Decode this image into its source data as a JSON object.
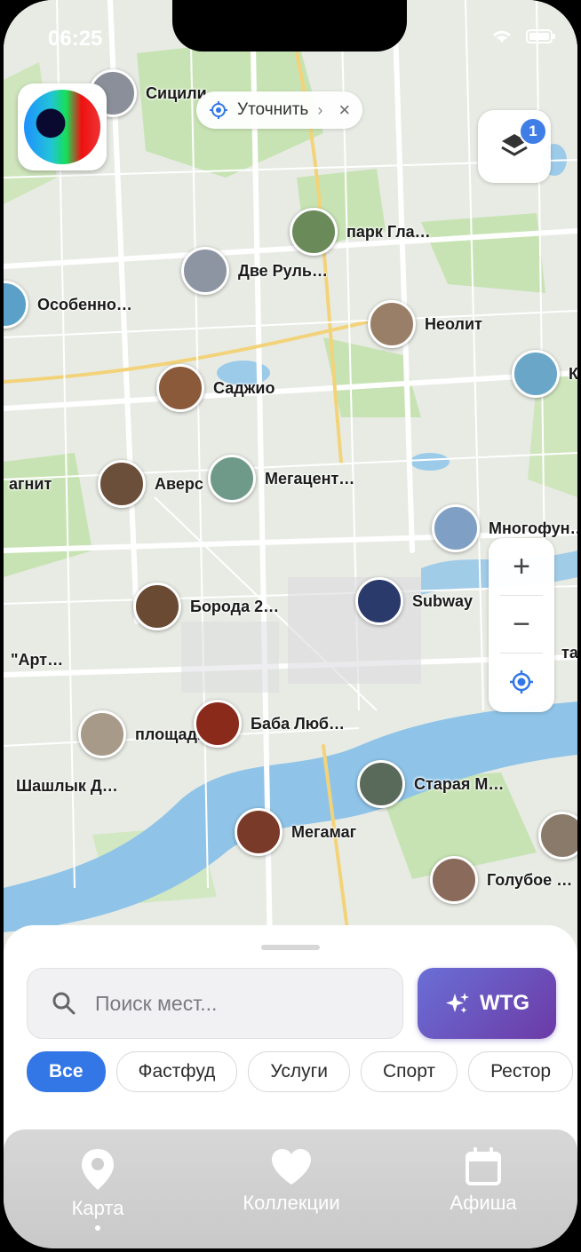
{
  "status_bar": {
    "time": "06:25"
  },
  "refine_pill": {
    "label": "Уточнить"
  },
  "layers": {
    "badge_count": "1"
  },
  "zoom": {
    "plus": "+",
    "minus": "−"
  },
  "places": [
    {
      "name": "Сицили",
      "photo_color": "#8a8f99"
    },
    {
      "name": "парк Гла…",
      "photo_color": "#6b8a5a"
    },
    {
      "name": "Две Руль…",
      "photo_color": "#8d95a3"
    },
    {
      "name": "Особенно…",
      "photo_color": "#5aa0c8"
    },
    {
      "name": "Неолит",
      "photo_color": "#9a7f68"
    },
    {
      "name": "Саджио",
      "photo_color": "#8a5a3a"
    },
    {
      "name": "К",
      "photo_color": "#6aa6c8"
    },
    {
      "name": "агнит",
      "photo_color": "#7a7a7a"
    },
    {
      "name": "Аверс",
      "photo_color": "#6b4f3a"
    },
    {
      "name": "Мегацент…",
      "photo_color": "#6f9a8a"
    },
    {
      "name": "Многофун…",
      "photo_color": "#7fa0c4"
    },
    {
      "name": "Борода 2…",
      "photo_color": "#6a4a33"
    },
    {
      "name": "Subway",
      "photo_color": "#2a3a6a"
    },
    {
      "name": "тар",
      "photo_color": "#aaaaaa"
    },
    {
      "name": "\"Арт…",
      "photo_color": "#aaaaaa"
    },
    {
      "name": "площадь",
      "photo_color": "#a89a88"
    },
    {
      "name": "Баба Люб…",
      "photo_color": "#8a2a1a"
    },
    {
      "name": "Шашлык Д…",
      "photo_color": "#aaaaaa"
    },
    {
      "name": "Старая М…",
      "photo_color": "#5a6a5a"
    },
    {
      "name": "Мегамаг",
      "photo_color": "#7a3a2a"
    },
    {
      "name": "Голубое …",
      "photo_color": "#8a6a5a"
    }
  ],
  "search": {
    "placeholder": "Поиск мест..."
  },
  "wtg_button": {
    "label": "WTG"
  },
  "categories": [
    "Все",
    "Фастфуд",
    "Услуги",
    "Спорт",
    "Рестор"
  ],
  "tabs": [
    {
      "label": "Карта",
      "icon": "map-pin-icon",
      "active": true
    },
    {
      "label": "Коллекции",
      "icon": "heart-icon",
      "active": false
    },
    {
      "label": "Афиша",
      "icon": "calendar-icon",
      "active": false
    }
  ],
  "colors": {
    "accent": "#3377e6",
    "wtg_start": "#6a6fd6",
    "wtg_end": "#6c3aa6",
    "river": "#8fc4e8",
    "park": "#bfe0a8"
  }
}
